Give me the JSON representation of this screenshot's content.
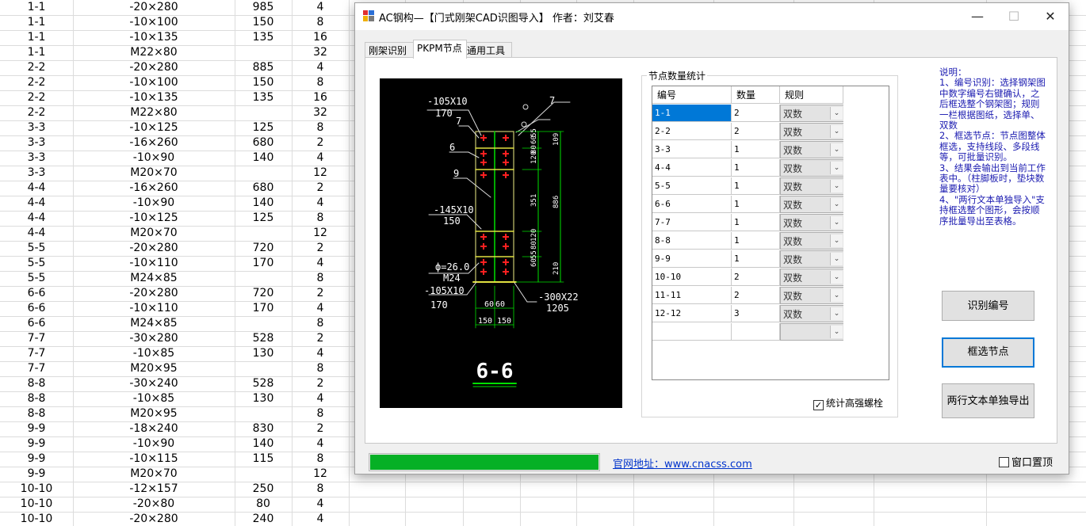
{
  "sheet": {
    "rows": [
      [
        "1-1",
        "-20×280",
        "985",
        "4"
      ],
      [
        "1-1",
        "-10×100",
        "150",
        "8"
      ],
      [
        "1-1",
        "-10×135",
        "135",
        "16"
      ],
      [
        "1-1",
        "M22×80",
        "",
        "32"
      ],
      [
        "2-2",
        "-20×280",
        "885",
        "4"
      ],
      [
        "2-2",
        "-10×100",
        "150",
        "8"
      ],
      [
        "2-2",
        "-10×135",
        "135",
        "16"
      ],
      [
        "2-2",
        "M22×80",
        "",
        "32"
      ],
      [
        "3-3",
        "-10×125",
        "125",
        "8"
      ],
      [
        "3-3",
        "-16×260",
        "680",
        "2"
      ],
      [
        "3-3",
        "-10×90",
        "140",
        "4"
      ],
      [
        "3-3",
        "M20×70",
        "",
        "12"
      ],
      [
        "4-4",
        "-16×260",
        "680",
        "2"
      ],
      [
        "4-4",
        "-10×90",
        "140",
        "4"
      ],
      [
        "4-4",
        "-10×125",
        "125",
        "8"
      ],
      [
        "4-4",
        "M20×70",
        "",
        "12"
      ],
      [
        "5-5",
        "-20×280",
        "720",
        "2"
      ],
      [
        "5-5",
        "-10×110",
        "170",
        "4"
      ],
      [
        "5-5",
        "M24×85",
        "",
        "8"
      ],
      [
        "6-6",
        "-20×280",
        "720",
        "2"
      ],
      [
        "6-6",
        "-10×110",
        "170",
        "4"
      ],
      [
        "6-6",
        "M24×85",
        "",
        "8"
      ],
      [
        "7-7",
        "-30×280",
        "528",
        "2"
      ],
      [
        "7-7",
        "-10×85",
        "130",
        "4"
      ],
      [
        "7-7",
        "M20×95",
        "",
        "8"
      ],
      [
        "8-8",
        "-30×240",
        "528",
        "2"
      ],
      [
        "8-8",
        "-10×85",
        "130",
        "4"
      ],
      [
        "8-8",
        "M20×95",
        "",
        "8"
      ],
      [
        "9-9",
        "-18×240",
        "830",
        "2"
      ],
      [
        "9-9",
        "-10×90",
        "140",
        "4"
      ],
      [
        "9-9",
        "-10×115",
        "115",
        "8"
      ],
      [
        "9-9",
        "M20×70",
        "",
        "12"
      ],
      [
        "10-10",
        "-12×157",
        "250",
        "8"
      ],
      [
        "10-10",
        "-20×80",
        "80",
        "4"
      ],
      [
        "10-10",
        "-20×280",
        "240",
        "4"
      ]
    ]
  },
  "dialog": {
    "title": "AC钢构—【门式刚架CAD识图导入】 作者：刘艾春",
    "minimize": "—",
    "maximize": "☐",
    "close": "✕",
    "tabs": [
      "刚架识别",
      "PKPM节点",
      "通用工具"
    ],
    "active_tab": 1,
    "cad": {
      "labels": [
        "-105X10",
        "170",
        "7",
        "6",
        "9",
        "-145X10",
        "150",
        "ф=26.0",
        "M24",
        "-105X10",
        "170",
        "-300X22",
        "1205",
        "60",
        "60",
        "150",
        "150",
        "109",
        "120",
        "80",
        "60",
        "55",
        "351",
        "886",
        "120",
        "80",
        "55",
        "60",
        "210",
        "7"
      ],
      "title": "6-6"
    },
    "group": {
      "title": "节点数量统计",
      "headers": [
        "编号",
        "数量",
        "规则"
      ],
      "rows": [
        {
          "id": "1-1",
          "qty": "2",
          "rule": "双数"
        },
        {
          "id": "2-2",
          "qty": "2",
          "rule": "双数"
        },
        {
          "id": "3-3",
          "qty": "1",
          "rule": "双数"
        },
        {
          "id": "4-4",
          "qty": "1",
          "rule": "双数"
        },
        {
          "id": "5-5",
          "qty": "1",
          "rule": "双数"
        },
        {
          "id": "6-6",
          "qty": "1",
          "rule": "双数"
        },
        {
          "id": "7-7",
          "qty": "1",
          "rule": "双数"
        },
        {
          "id": "8-8",
          "qty": "1",
          "rule": "双数"
        },
        {
          "id": "9-9",
          "qty": "1",
          "rule": "双数"
        },
        {
          "id": "10-10",
          "qty": "2",
          "rule": "双数"
        },
        {
          "id": "11-11",
          "qty": "2",
          "rule": "双数"
        },
        {
          "id": "12-12",
          "qty": "3",
          "rule": "双数"
        },
        {
          "id": "",
          "qty": "",
          "rule": ""
        }
      ],
      "checkbox_label": "统计高强螺栓",
      "checkbox_checked": true
    },
    "notes": [
      "说明：",
      "1、编号识别：选择钢架图中数字编号右键确认，之后框选整个钢架图；规则一栏根据图纸，选择单、双数",
      "2、框选节点：节点图整体框选，支持线段、多段线等，可批量识别。",
      "3、结果会输出到当前工作表中。（柱脚板时，垫块数量要核对）",
      "4、\"两行文本单独导入\"支持框选整个图形，会按顺序批量导出至表格。"
    ],
    "buttons": {
      "identify": "识别编号",
      "select_nodes": "框选节点",
      "export_two_line": "两行文本单独导出"
    },
    "progress": 1.0,
    "website": "官网地址：www.cnacss.com",
    "ontop_label": "窗口置顶",
    "ontop_checked": false,
    "accent": "#0078d7",
    "progress_color": "#06b025",
    "note_color": "#1a1ab0",
    "cad_green": "#00e000",
    "cad_red": "#ff2020"
  }
}
